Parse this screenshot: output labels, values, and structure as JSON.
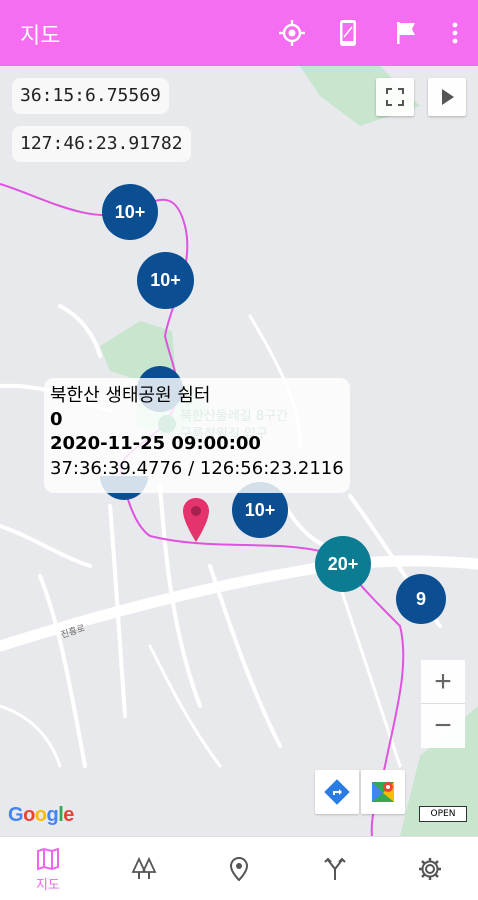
{
  "appbar": {
    "title": "지도",
    "actions": [
      "crosshair-icon",
      "phone-icon",
      "flag-icon",
      "more-vert-icon"
    ]
  },
  "map": {
    "latitude": "36:15:6.75569",
    "longitude": "127:46:23.91782",
    "clusters": [
      "10+",
      "10+",
      "10+",
      "20+",
      "9"
    ],
    "info": {
      "name": "북한산  생태공원 쉼터",
      "value": "0",
      "datetime": "2020-11-25 09:00:00",
      "coords": "37:36:39.4776 / 126:56:23.2116"
    },
    "zoom_in": "+",
    "zoom_out": "−",
    "attribution": "Google",
    "osm": "OPEN"
  },
  "bottom_nav": {
    "active_label": "지도",
    "items": [
      "map-icon",
      "trees-icon",
      "location-pin-icon",
      "fork-icon",
      "settings-icon"
    ]
  },
  "colors": {
    "appbar": "#f56df0",
    "cluster_blue": "#0b4f92",
    "cluster_teal": "#0c7c93",
    "route": "#e052e0",
    "marker": "#e5336e"
  }
}
